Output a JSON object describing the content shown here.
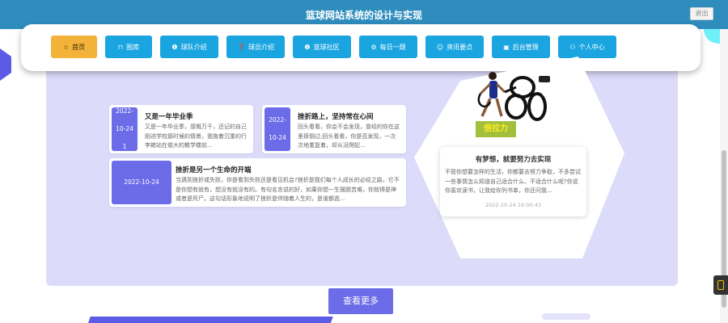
{
  "header": {
    "title": "篮球网站系统的设计与实现",
    "logout_label": "退出",
    "background_color": "#2f8dbe"
  },
  "nav": {
    "items": [
      {
        "label": "首页",
        "icon": "star-icon",
        "glyph": "☆",
        "active": true
      },
      {
        "label": "图库",
        "icon": "bag-icon",
        "glyph": "⊓",
        "active": false
      },
      {
        "label": "球队介绍",
        "icon": "info-icon",
        "glyph": "❶",
        "active": false
      },
      {
        "label": "球员介绍",
        "icon": "help-icon",
        "glyph": "❓",
        "active": false
      },
      {
        "label": "篮球社区",
        "icon": "info-icon",
        "glyph": "❶",
        "active": false
      },
      {
        "label": "每日一题",
        "icon": "gear-icon",
        "glyph": "⚙",
        "active": false
      },
      {
        "label": "资讯要点",
        "icon": "smile-icon",
        "glyph": "☺",
        "active": false
      },
      {
        "label": "后台管理",
        "icon": "box-icon",
        "glyph": "▣",
        "active": false
      },
      {
        "label": "个人中心",
        "icon": "user-icon",
        "glyph": "⚇",
        "active": false
      }
    ],
    "active_color": "#f3b33a",
    "button_color": "#1ba5e0"
  },
  "news": [
    {
      "date": "2022-10-241",
      "title": "又是一年毕业季",
      "excerpt": "又是一年毕业季，感慨万千，还记的自己刚进学校那时候的情景，我拖着沉重的行李箱站在偌大的教学楼前..."
    },
    {
      "date": "2022-10-24",
      "title": "挫折路上，坚持常在心间",
      "excerpt": "回头看看，你会不会发现，曾经的你在这里摔倒过;回头看看，你是否发现，一次次地重复着，却从没爬起..."
    },
    {
      "date": "2022-10-24",
      "title": "挫折是另一个生命的开端",
      "excerpt": "当遇到挫折或失败，你是看到失败还是看见机会?挫折是我们每个人成长的必经之路，它不是你想有就有，想没有就没有的。有句名言说的好，如果你想一生摆脱苦难，你就得是神或者是死尸。这句话形象地说明了挫折是伴随着人生的，是谁都逃..."
    }
  ],
  "featured": {
    "image_caption": "倍拉力",
    "title": "有梦想，就要努力去实现",
    "text": "不管你想要怎样的生活，你都要去努力争取，不多尝试一些事情怎么知道自己适合什么、不适合什么呢?你说你喜欢读书，让我给你列书单，你还问我...",
    "date": "2022-10-24 16:00:43"
  },
  "more_button_label": "查看更多",
  "colors": {
    "panel": "#dcdcfa",
    "accent": "#6c6be8"
  }
}
